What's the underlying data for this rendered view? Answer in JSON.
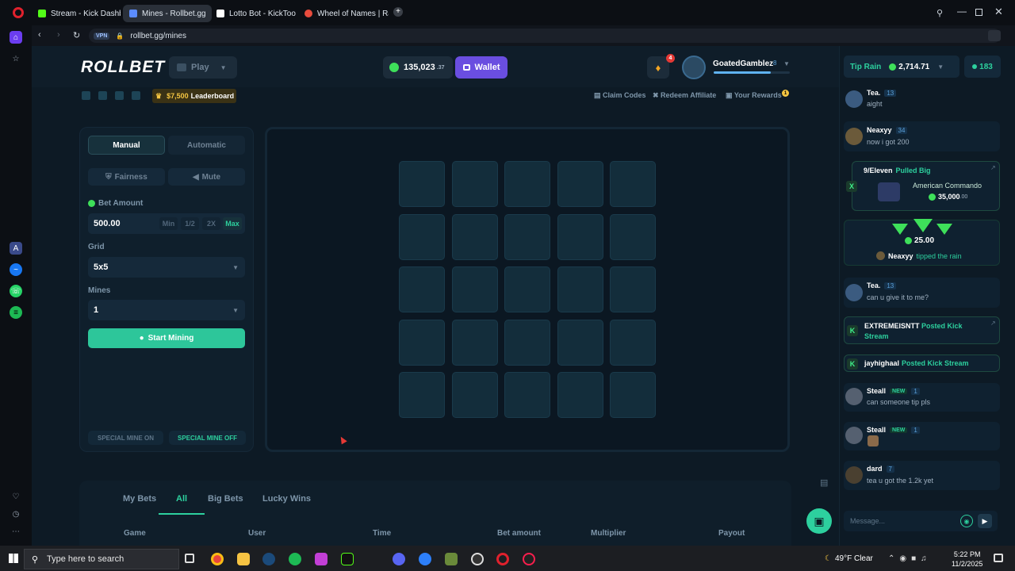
{
  "browser": {
    "tabs": [
      {
        "label": "Stream - Kick Dashboard",
        "color": "#53fc18"
      },
      {
        "label": "Mines - Rollbet.gg",
        "color": "#5b8cff"
      },
      {
        "label": "Lotto Bot - KickTools",
        "color": "#ffffff"
      },
      {
        "label": "Wheel of Names | Random",
        "color": "#e84c3d"
      }
    ],
    "new_tab": "+",
    "vpn": "VPN",
    "url": "rollbet.gg/mines"
  },
  "header": {
    "logo": "ROLLBET",
    "play": "Play",
    "balance_main": "135,023",
    "balance_cents": ".37",
    "wallet": "Wallet",
    "notif_count": "4",
    "username": "GoatedGamblez",
    "user_level": "8"
  },
  "subbar": {
    "leaderboard_amount": "$7,500",
    "leaderboard_label": "Leaderboard",
    "claim_codes": "Claim Codes",
    "redeem_affiliate": "Redeem Affiliate",
    "your_rewards": "Your Rewards",
    "rewards_count": "1"
  },
  "panel": {
    "manual": "Manual",
    "automatic": "Automatic",
    "fairness": "Fairness",
    "mute": "Mute",
    "bet_amount_label": "Bet Amount",
    "bet_amount": "500.00",
    "min": "Min",
    "half": "1/2",
    "double": "2X",
    "max": "Max",
    "grid_label": "Grid",
    "grid_value": "5x5",
    "mines_label": "Mines",
    "mines_value": "1",
    "start": "Start Mining",
    "special_on": "SPECIAL MINE ON",
    "special_off": "SPECIAL MINE OFF"
  },
  "bets": {
    "tabs": [
      "My Bets",
      "All",
      "Big Bets",
      "Lucky Wins"
    ],
    "columns": [
      "Game",
      "User",
      "Time",
      "Bet amount",
      "Multiplier",
      "Payout"
    ]
  },
  "chat": {
    "tip_rain_label": "Tip Rain",
    "tip_rain_amount": "2,714.71",
    "online": "183",
    "messages": [
      {
        "name": "Tea.",
        "level": "13",
        "text": "aight"
      },
      {
        "name": "Neaxyy",
        "level": "34",
        "text": "now i got 200"
      },
      {
        "name": "9/Eleven",
        "action": "Pulled Big",
        "game": "American Commando",
        "amount": "35,000",
        "cents": ".00"
      },
      {
        "amount": "25.00",
        "name": "Neaxyy",
        "action": "tipped the rain"
      },
      {
        "name": "Tea.",
        "level": "13",
        "text": "can u give it to me?"
      },
      {
        "name": "EXTREMEISNTT",
        "action": "Posted Kick Stream"
      },
      {
        "name": "jayhighaal",
        "action": "Posted Kick Stream"
      },
      {
        "name": "Steall",
        "new": "NEW",
        "level": "1",
        "text": "can someone tip pls"
      },
      {
        "name": "Steall",
        "new": "NEW",
        "level": "1",
        "text": ""
      },
      {
        "name": "dard",
        "level": "7",
        "text": "tea u got the 1.2k yet"
      }
    ],
    "input_placeholder": "Message..."
  },
  "taskbar": {
    "search_placeholder": "Type here to search",
    "weather": "49°F  Clear",
    "time": "5:22 PM",
    "date": "11/2/2025"
  }
}
